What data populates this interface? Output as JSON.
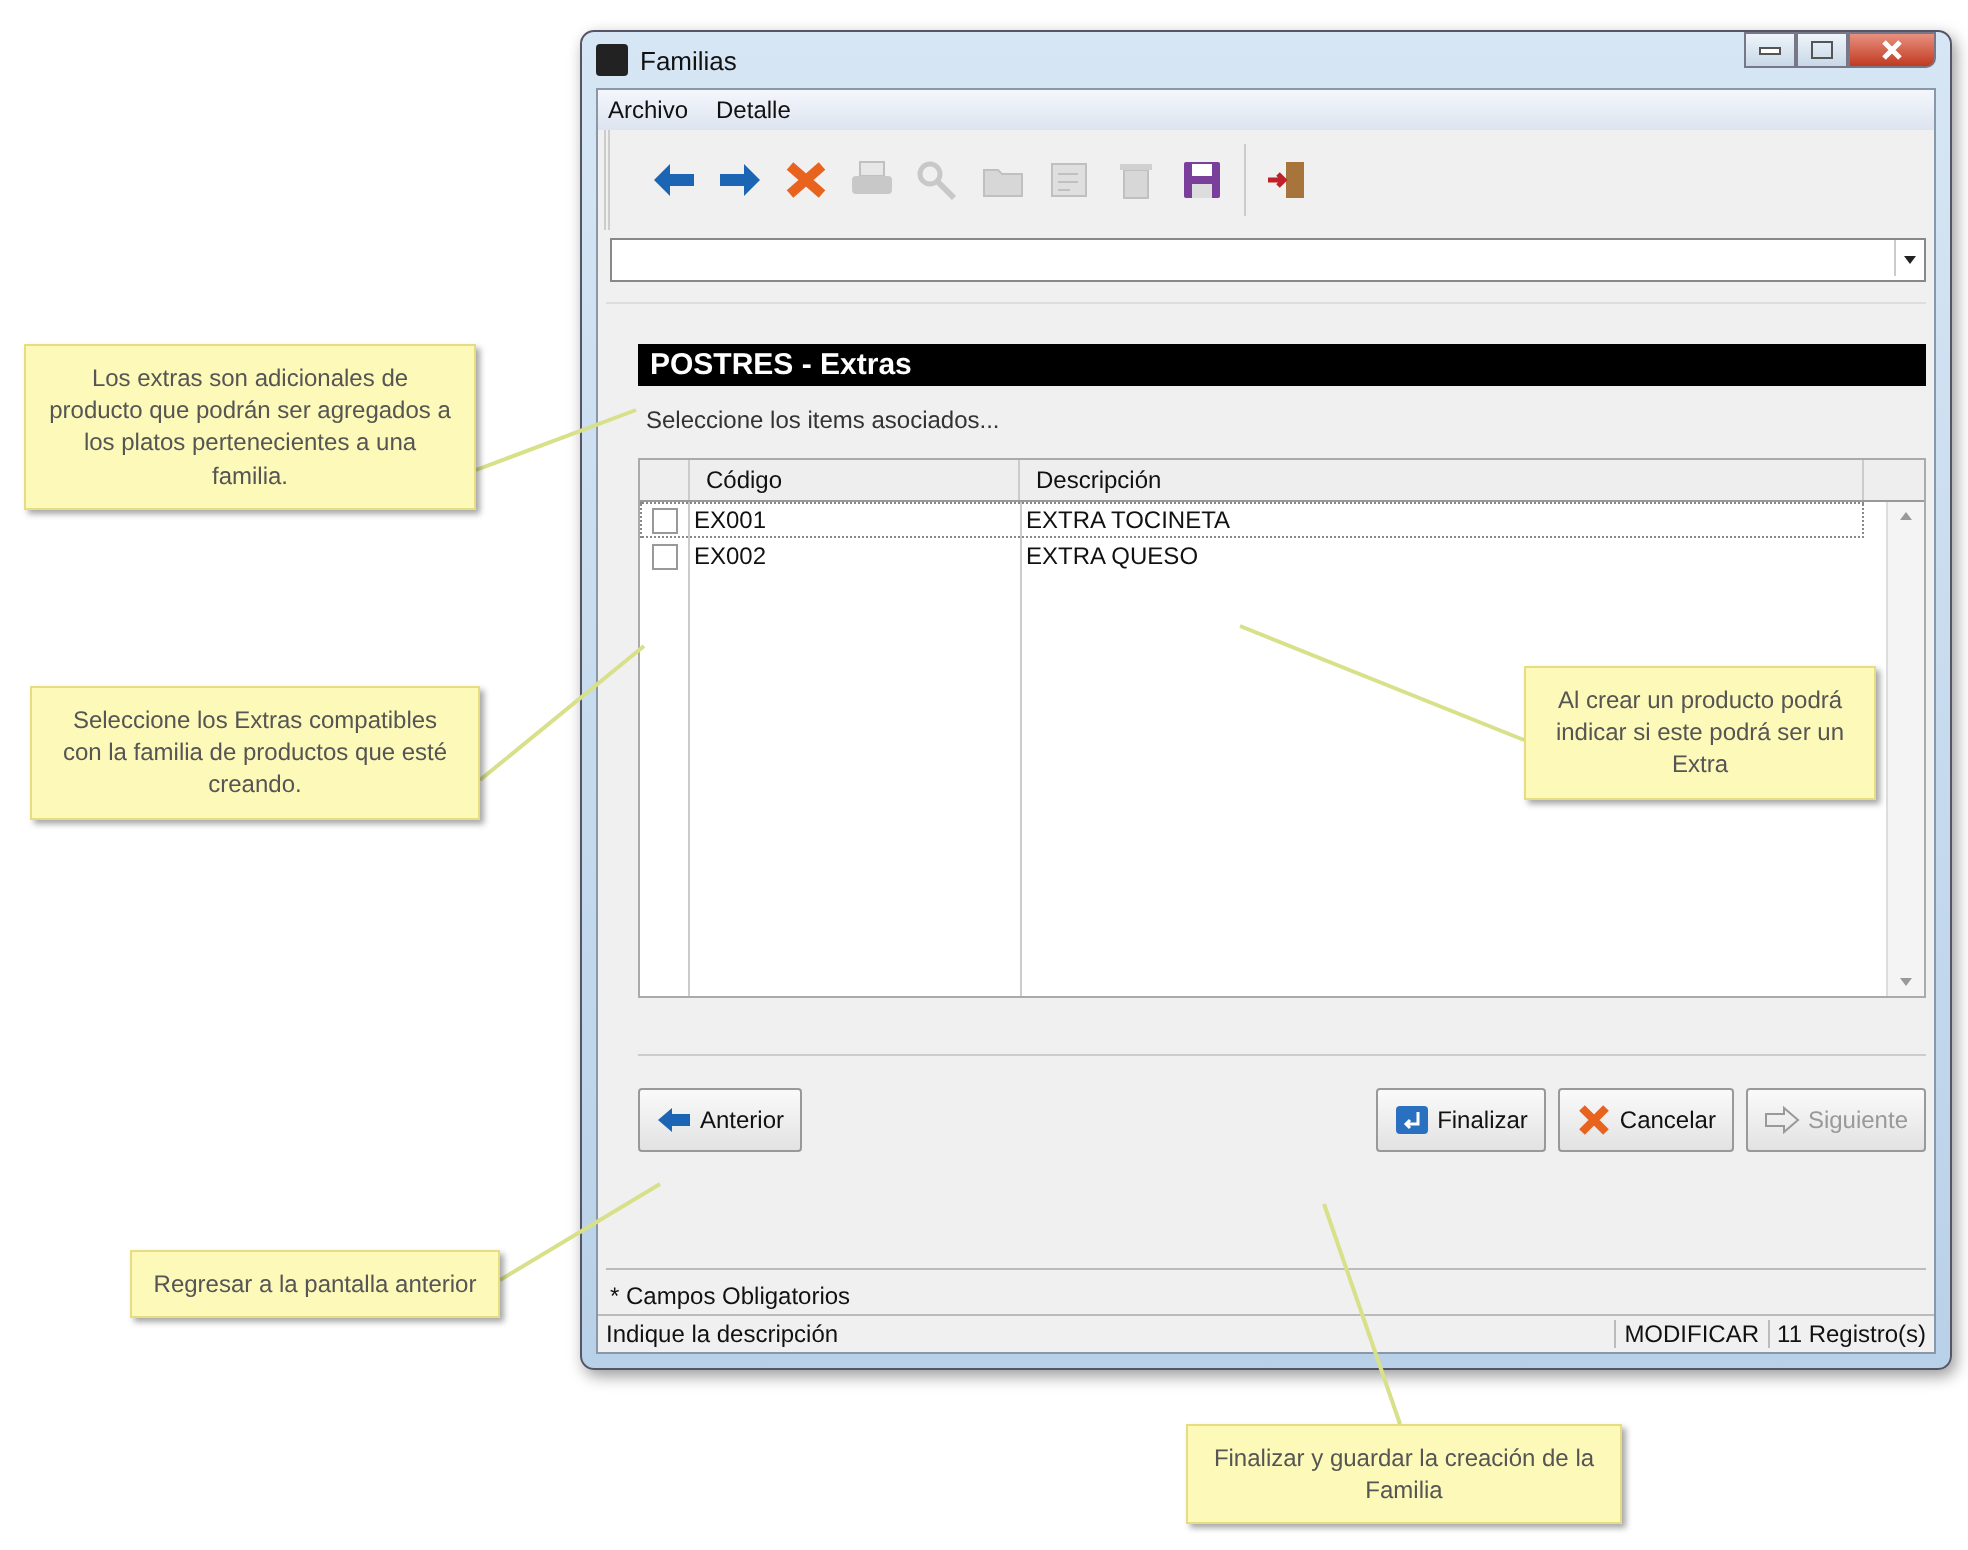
{
  "window": {
    "title": "Familias"
  },
  "menu": [
    "Archivo",
    "Detalle"
  ],
  "toolbar": [
    {
      "kind": "back",
      "disabled": false
    },
    {
      "kind": "forward",
      "disabled": false
    },
    {
      "kind": "delete",
      "disabled": false
    },
    {
      "kind": "print",
      "disabled": true
    },
    {
      "kind": "search",
      "disabled": true
    },
    {
      "kind": "folder",
      "disabled": true
    },
    {
      "kind": "edit",
      "disabled": true
    },
    {
      "kind": "trash",
      "disabled": true
    },
    {
      "kind": "save",
      "disabled": false
    },
    {
      "kind": "separator"
    },
    {
      "kind": "exit",
      "disabled": false
    }
  ],
  "header": "POSTRES - Extras",
  "subtitle": "Seleccione los items asociados...",
  "table": {
    "columns": [
      "Código",
      "Descripción"
    ],
    "rows": [
      {
        "code": "EX001",
        "description": "EXTRA TOCINETA",
        "checked": false,
        "selected": true
      },
      {
        "code": "EX002",
        "description": "EXTRA QUESO",
        "checked": false,
        "selected": false
      }
    ]
  },
  "buttons": [
    {
      "kind": "back",
      "label": "Anterior",
      "disabled": false
    },
    {
      "kind": "finish",
      "label": "Finalizar",
      "disabled": false
    },
    {
      "kind": "cancel",
      "label": "Cancelar",
      "disabled": false
    },
    {
      "kind": "next",
      "label": "Siguiente",
      "disabled": true
    }
  ],
  "required_note": "* Campos Obligatorios",
  "status_bar": [
    "Indique la descripción",
    "MODIFICAR",
    "11 Registro(s)"
  ],
  "callouts": [
    "Los extras son adicionales de producto que podrán ser agregados a los platos pertenecientes a una familia.",
    "Seleccione los Extras compatibles con la familia de productos que esté creando.",
    "Al crear un producto podrá indicar si este podrá ser un Extra",
    "Regresar a la pantalla anterior",
    "Finalizar y guardar la creación de la Familia"
  ]
}
